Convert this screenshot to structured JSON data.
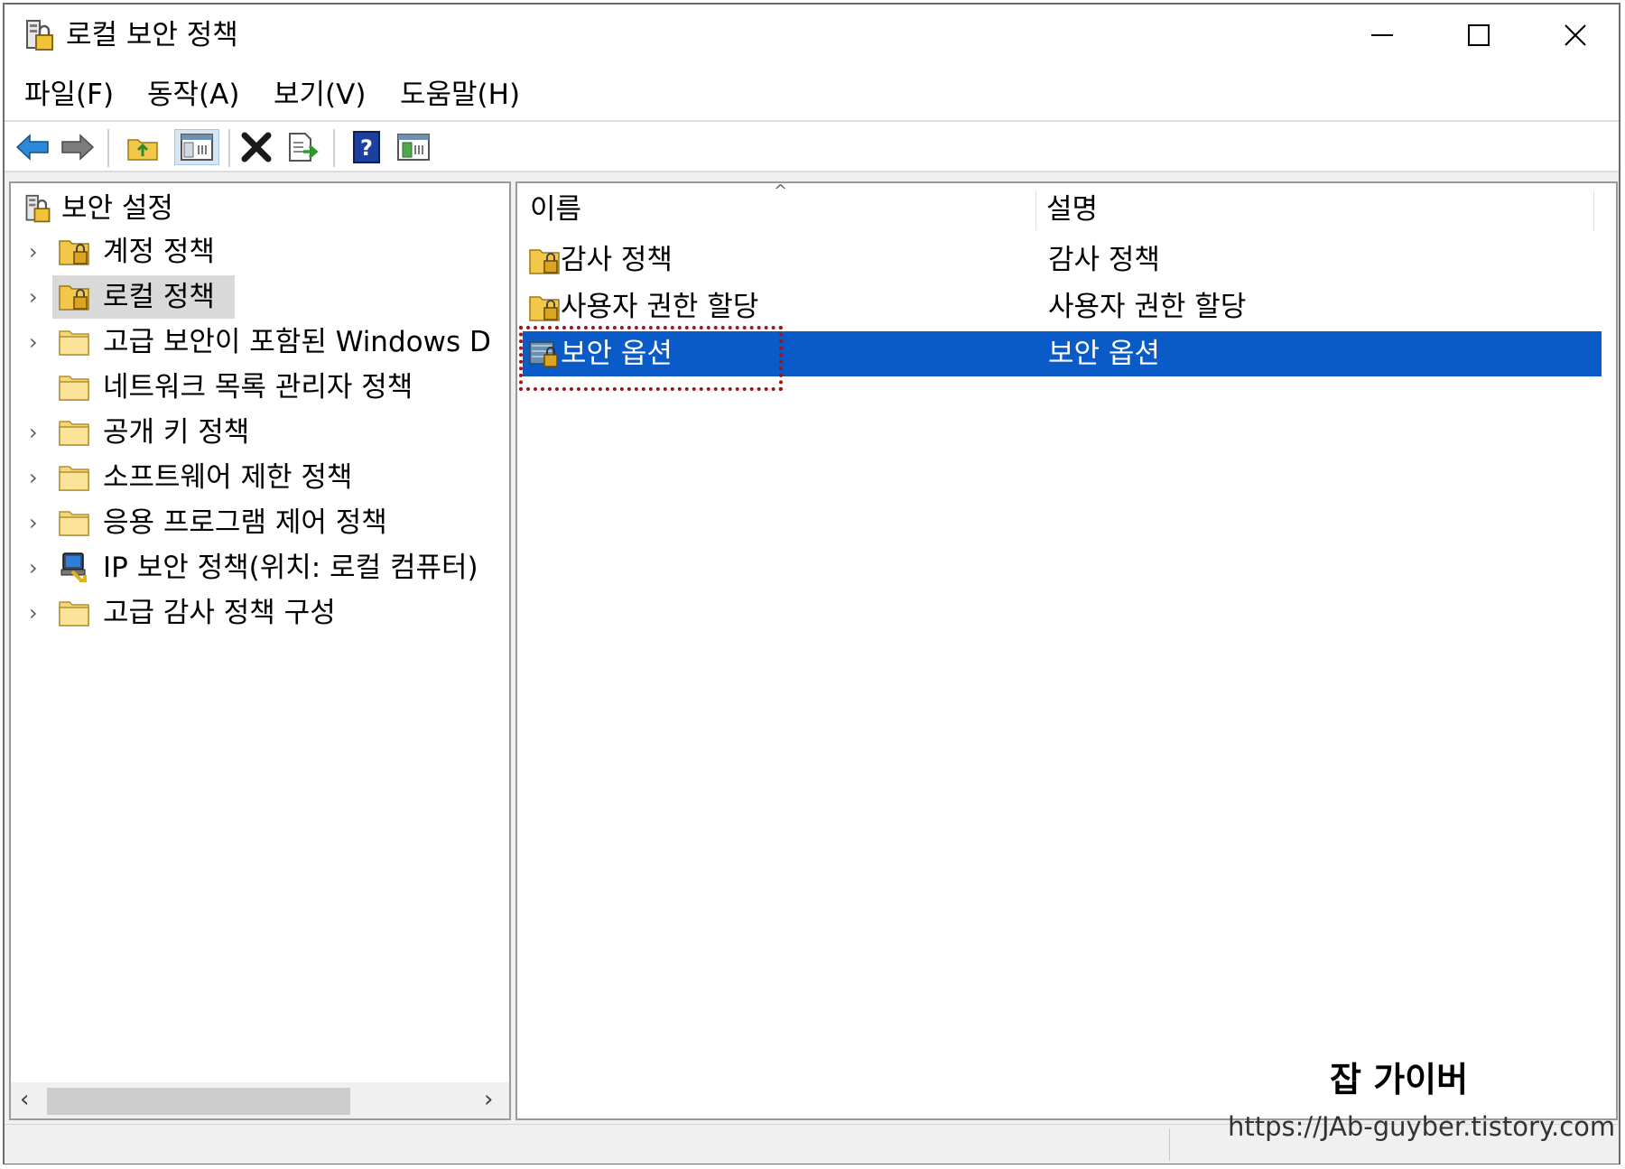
{
  "window": {
    "title": "로컬 보안 정책"
  },
  "menu": [
    {
      "label": "파일(F)"
    },
    {
      "label": "동작(A)"
    },
    {
      "label": "보기(V)"
    },
    {
      "label": "도움말(H)"
    }
  ],
  "tree": {
    "root_label": "보안 설정",
    "items": [
      {
        "label": "계정 정책",
        "icon": "policy-folder-icon",
        "expandable": true
      },
      {
        "label": "로컬 정책",
        "icon": "policy-folder-icon",
        "expandable": true,
        "selected": true
      },
      {
        "label": "고급 보안이 포함된 Windows D",
        "icon": "folder-icon",
        "expandable": true
      },
      {
        "label": "네트워크 목록 관리자 정책",
        "icon": "folder-icon",
        "expandable": false
      },
      {
        "label": "공개 키 정책",
        "icon": "folder-icon",
        "expandable": true
      },
      {
        "label": "소프트웨어 제한 정책",
        "icon": "folder-icon",
        "expandable": true
      },
      {
        "label": "응용 프로그램 제어 정책",
        "icon": "folder-icon",
        "expandable": true
      },
      {
        "label": "IP 보안 정책(위치: 로컬 컴퓨터)",
        "icon": "ip-security-icon",
        "expandable": true
      },
      {
        "label": "고급 감사 정책 구성",
        "icon": "folder-icon",
        "expandable": true
      }
    ]
  },
  "list": {
    "columns": [
      {
        "label": "이름"
      },
      {
        "label": "설명"
      }
    ],
    "rows": [
      {
        "name": "감사 정책",
        "description": "감사 정책",
        "icon": "policy-folder-icon"
      },
      {
        "name": "사용자 권한 할당",
        "description": "사용자 권한 할당",
        "icon": "policy-folder-icon"
      },
      {
        "name": "보안 옵션",
        "description": "보안 옵션",
        "icon": "security-options-icon",
        "selected": true
      }
    ]
  },
  "watermark": {
    "name": "잡 가이버",
    "url": "https://JAb-guyber.tistory.com"
  },
  "colors": {
    "selection": "#0a5bc7",
    "highlight_border": "#a0141a"
  }
}
